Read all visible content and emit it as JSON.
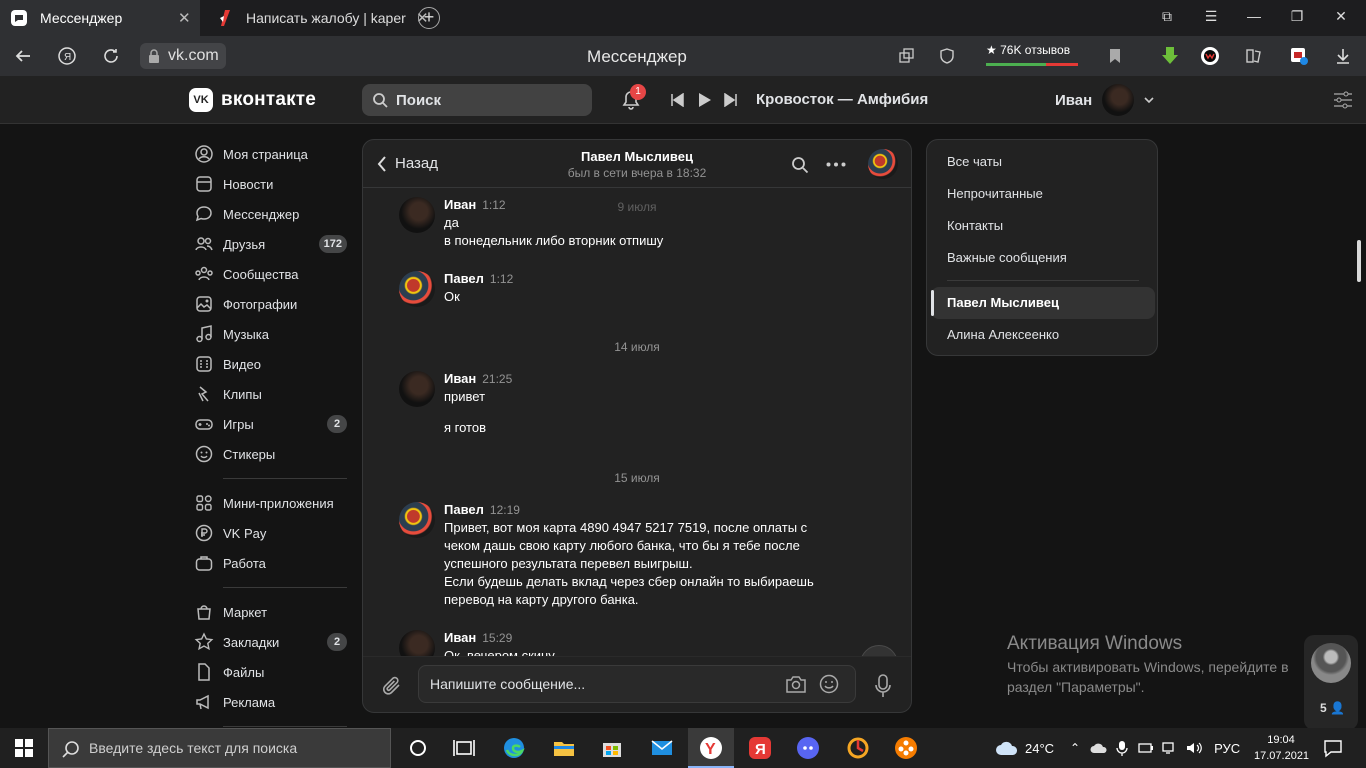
{
  "browser": {
    "tabs": [
      {
        "title": "Мессенджер"
      },
      {
        "title": "Написать жалобу | kaper.p"
      }
    ],
    "url": "vk.com",
    "page_title": "Мессенджер",
    "reviews_label": "★ 76K отзывов",
    "reviews_rating_fraction": 0.65,
    "download_badge": "1"
  },
  "vk": {
    "logo_text": "вконтакте",
    "search_placeholder": "Поиск",
    "notification_count": "1",
    "track": "Кровосток — Амфибия",
    "user_name": "Иван"
  },
  "menu": {
    "items": [
      {
        "label": "Моя страница",
        "icon": "user-circle-icon"
      },
      {
        "label": "Новости",
        "icon": "news-icon"
      },
      {
        "label": "Мессенджер",
        "icon": "message-icon"
      },
      {
        "label": "Друзья",
        "icon": "friends-icon",
        "count": "172"
      },
      {
        "label": "Сообщества",
        "icon": "communities-icon"
      },
      {
        "label": "Фотографии",
        "icon": "photo-icon"
      },
      {
        "label": "Музыка",
        "icon": "music-icon"
      },
      {
        "label": "Видео",
        "icon": "video-icon"
      },
      {
        "label": "Клипы",
        "icon": "clips-icon"
      },
      {
        "label": "Игры",
        "icon": "games-icon",
        "count": "2"
      },
      {
        "label": "Стикеры",
        "icon": "sticker-icon"
      },
      {
        "label": "Мини-приложения",
        "icon": "apps-icon"
      },
      {
        "label": "VK Pay",
        "icon": "vkpay-icon"
      },
      {
        "label": "Работа",
        "icon": "briefcase-icon"
      },
      {
        "label": "Маркет",
        "icon": "bag-icon"
      },
      {
        "label": "Закладки",
        "icon": "star-icon",
        "count": "2"
      },
      {
        "label": "Файлы",
        "icon": "file-icon"
      },
      {
        "label": "Реклама",
        "icon": "megaphone-icon"
      }
    ]
  },
  "chat": {
    "back_label": "Назад",
    "contact_name": "Павел Мысливец",
    "contact_status": "был в сети вчера в 18:32",
    "dates": [
      "9 июля",
      "14 июля",
      "15 июля"
    ],
    "messages": [
      {
        "author": "Иван",
        "time": "1:12",
        "lines": [
          "да",
          "в понедельник либо вторник отпишу"
        ]
      },
      {
        "author": "Павел",
        "time": "1:12",
        "lines": [
          "Ок"
        ]
      },
      {
        "author": "Иван",
        "time": "21:25",
        "lines": [
          "привет",
          "я готов"
        ]
      },
      {
        "author": "Павел",
        "time": "12:19",
        "lines": [
          "Привет, вот моя карта 4890 4947 5217 7519, после оплаты с",
          "чеком дашь свою карту любого банка, что бы я тебе после",
          "успешного результата перевел выигрыш.",
          "Если будешь делать вклад через сбер онлайн то выбираешь",
          "перевод на карту другого банка."
        ]
      },
      {
        "author": "Иван",
        "time": "15:29",
        "lines": [
          "Ок, вечером скину"
        ]
      }
    ],
    "input_placeholder": "Напишите сообщение..."
  },
  "folders": {
    "items": [
      "Все чаты",
      "Непрочитанные",
      "Контакты",
      "Важные сообщения"
    ],
    "chats": [
      "Павел Мысливец",
      "Алина Алексеенко"
    ],
    "active_chat": "Павел Мысливец"
  },
  "watermark": {
    "title": "Активация Windows",
    "line1": "Чтобы активировать Windows, перейдите в",
    "line2": "раздел \"Параметры\"."
  },
  "side_bubble_count": "5",
  "taskbar": {
    "search_placeholder": "Введите здесь текст для поиска",
    "weather": "24°C",
    "lang": "РУС",
    "time": "19:04",
    "date": "17.07.2021"
  }
}
